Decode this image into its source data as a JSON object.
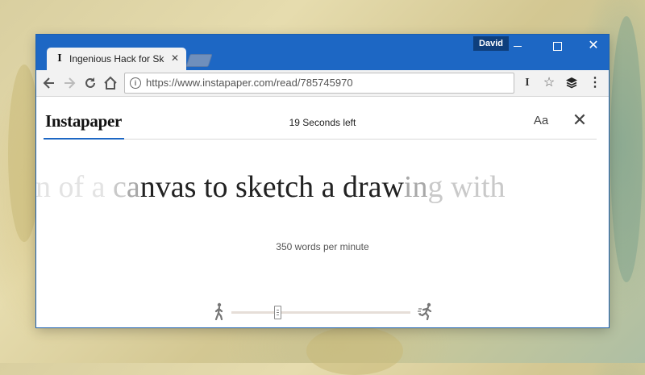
{
  "browser": {
    "tab_title": "Ingenious Hack for Sketc",
    "tab_favicon": "I",
    "profile_name": "David",
    "url": "https://www.instapaper.com/read/785745970",
    "extension_instapaper_glyph": "I",
    "accent_color": "#1d67c4"
  },
  "app": {
    "brand": "Instapaper",
    "timer": "19 Seconds left",
    "font_button": "Aa",
    "close_glyph": "✕"
  },
  "reader": {
    "text_segments": [
      {
        "text": "on of a ",
        "tone": "faint"
      },
      {
        "text": "c",
        "tone": "light"
      },
      {
        "text": "a",
        "tone": "mid"
      },
      {
        "text": "nvas to sketch a draw",
        "tone": "dark"
      },
      {
        "text": "in",
        "tone": "mid"
      },
      {
        "text": "g with",
        "tone": "light"
      }
    ],
    "wpm_label": "350 words per minute",
    "slider_fraction": 0.26
  },
  "icons": {
    "back": "back-arrow-icon",
    "forward": "forward-arrow-icon",
    "reload": "reload-icon",
    "home": "home-icon",
    "info": "info-icon",
    "star": "star-icon",
    "buffer": "buffer-icon",
    "menu": "kebab-menu-icon",
    "slow": "walking-person-icon",
    "fast": "running-person-icon"
  }
}
